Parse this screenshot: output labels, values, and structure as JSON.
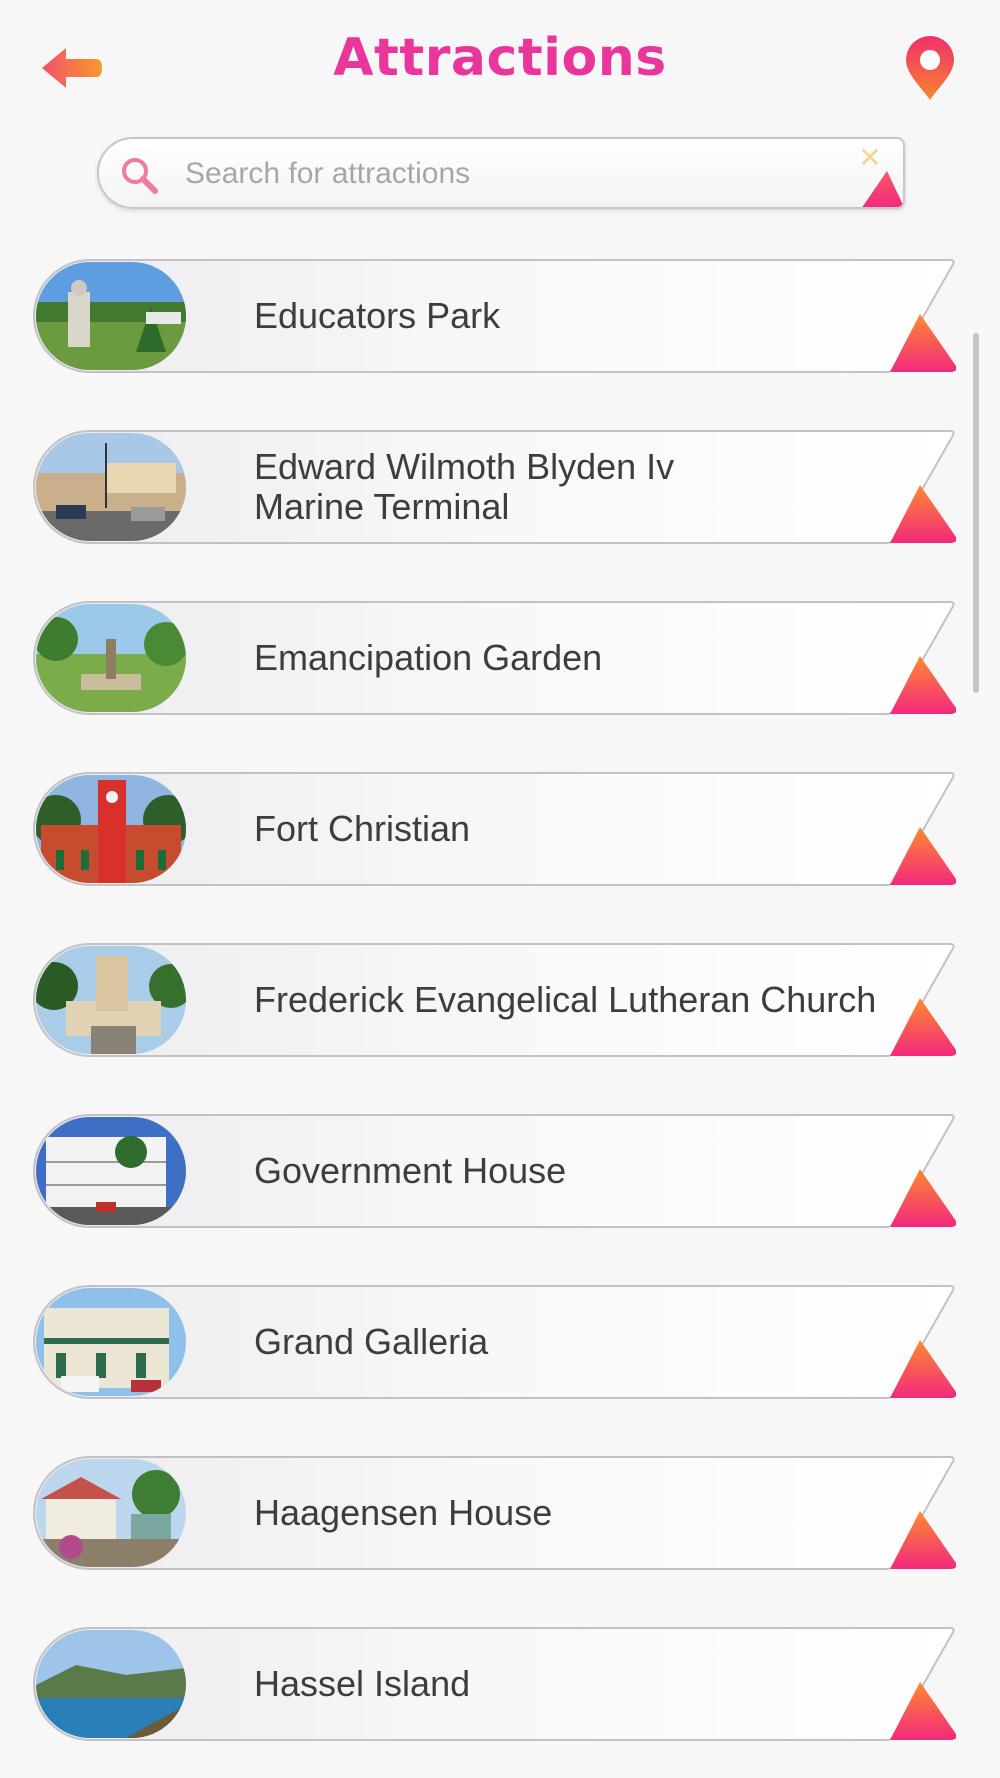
{
  "header": {
    "title": "Attractions",
    "back_icon": "arrow-left-icon",
    "map_icon": "map-pin-icon"
  },
  "search": {
    "placeholder": "Search for attractions",
    "value": "",
    "search_icon": "search-icon",
    "clear_icon": "close-icon",
    "clear_glyph": "✕"
  },
  "attractions": [
    {
      "name": "Educators Park",
      "thumb": "park-statue"
    },
    {
      "name": "Edward Wilmoth Blyden Iv Marine Terminal",
      "thumb": "street-terminal"
    },
    {
      "name": "Emancipation Garden",
      "thumb": "garden-gazebo"
    },
    {
      "name": "Fort Christian",
      "thumb": "red-fort"
    },
    {
      "name": "Frederick Evangelical Lutheran Church",
      "thumb": "church"
    },
    {
      "name": "Government House",
      "thumb": "white-mansion"
    },
    {
      "name": "Grand Galleria",
      "thumb": "galleria-building"
    },
    {
      "name": "Haagensen House",
      "thumb": "house-garden"
    },
    {
      "name": "Hassel Island",
      "thumb": "island-bay"
    }
  ],
  "colors": {
    "accent": "#e8369a",
    "back_arrow": "#f26a3c",
    "corner_gradient_top": "#ff8a30",
    "corner_gradient_bottom": "#f2297d",
    "text": "#3d3d3f"
  }
}
